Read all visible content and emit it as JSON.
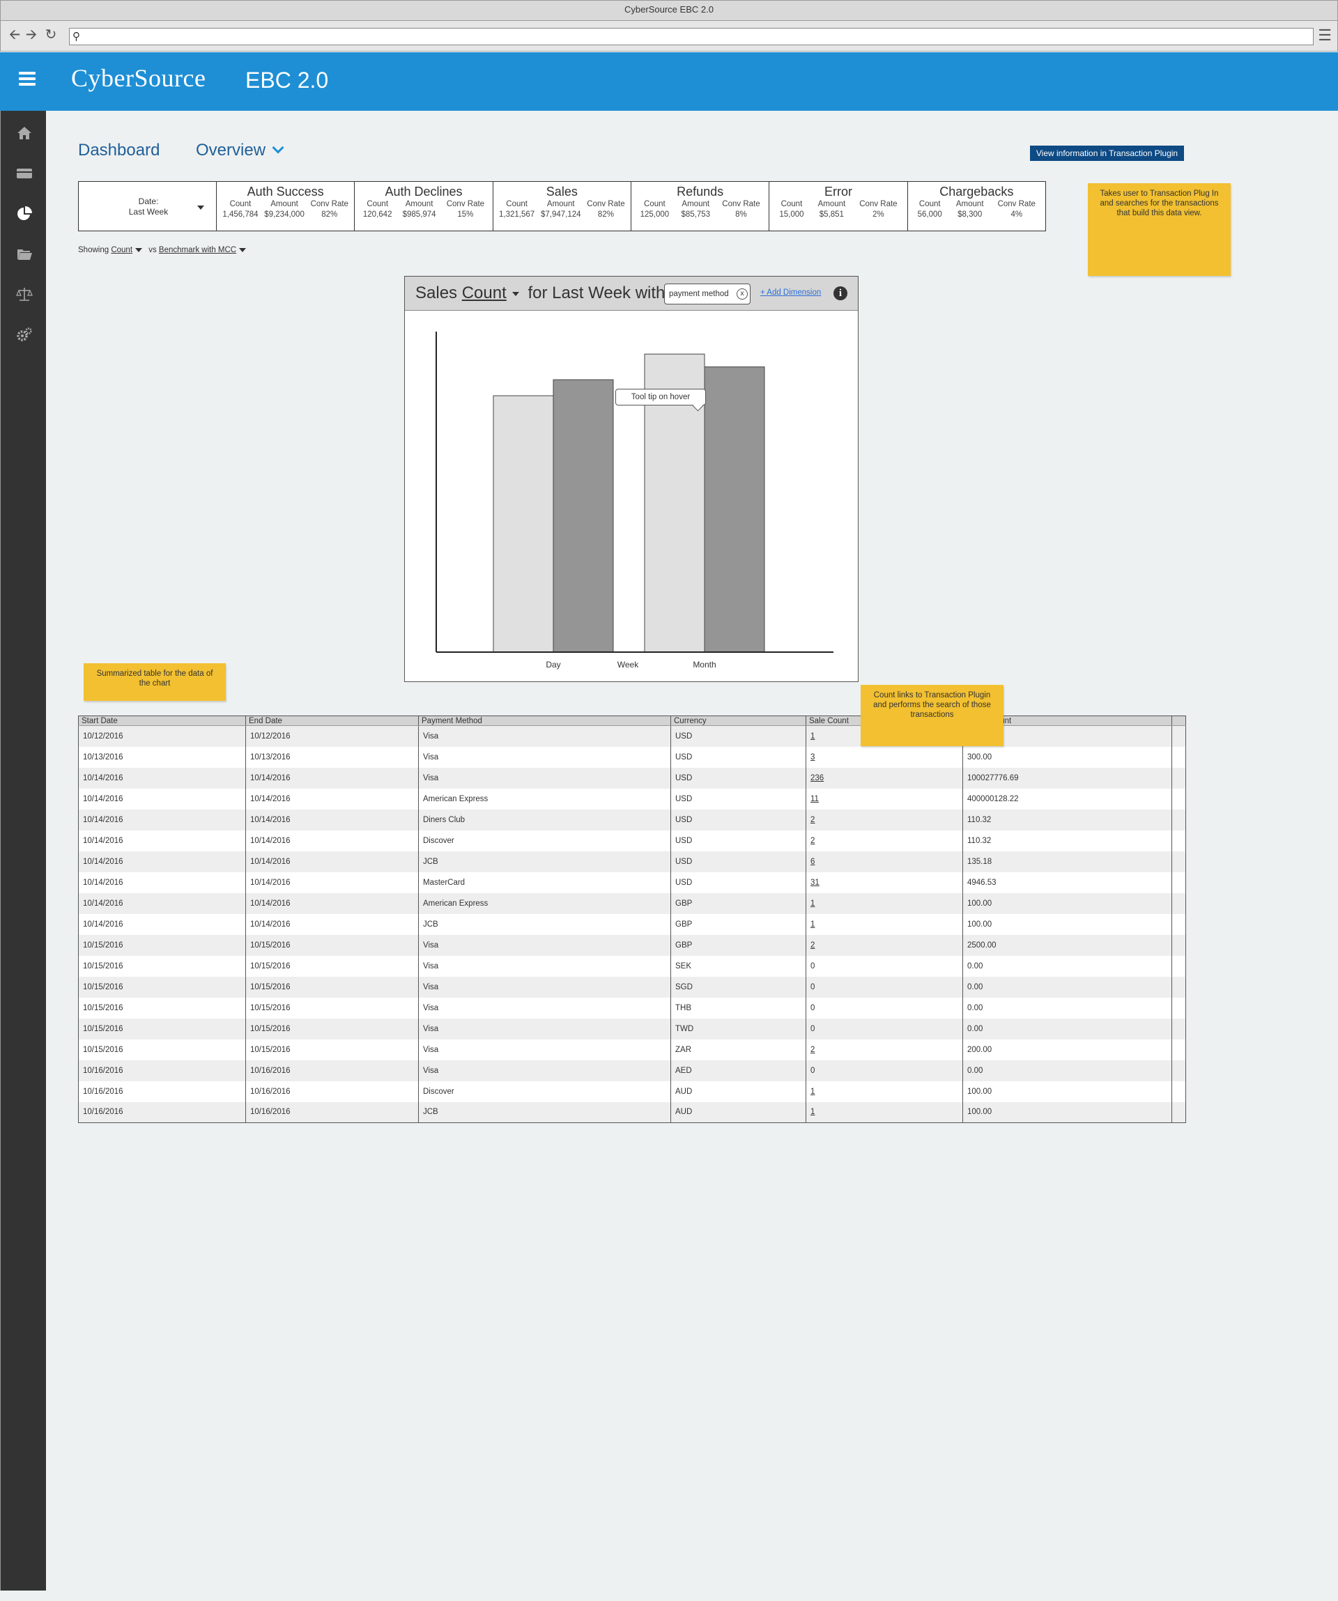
{
  "browser": {
    "title": "CyberSource EBC 2.0",
    "url": ""
  },
  "header": {
    "brand": "CyberSource",
    "product": "EBC 2.0"
  },
  "sidebar": {
    "items": [
      {
        "icon": "home-icon"
      },
      {
        "icon": "credit-card-icon"
      },
      {
        "icon": "pie-chart-icon",
        "active": true
      },
      {
        "icon": "folder-icon"
      },
      {
        "icon": "scale-icon"
      },
      {
        "icon": "gears-icon"
      }
    ]
  },
  "page": {
    "dashboard_label": "Dashboard",
    "overview_label": "Overview",
    "transaction_button": "View information in Transaction Plugin"
  },
  "metrics": {
    "date_label": "Date:",
    "date_value": "Last Week",
    "groups": [
      {
        "title": "Auth Success",
        "cols": [
          {
            "label": "Count",
            "value": "1,456,784"
          },
          {
            "label": "Amount",
            "value": "$9,234,000"
          },
          {
            "label": "Conv Rate",
            "value": "82%"
          }
        ]
      },
      {
        "title": "Auth Declines",
        "cols": [
          {
            "label": "Count",
            "value": "120,642"
          },
          {
            "label": "Amount",
            "value": "$985,974"
          },
          {
            "label": "Conv Rate",
            "value": "15%"
          }
        ]
      },
      {
        "title": "Sales",
        "cols": [
          {
            "label": "Count",
            "value": "1,321,567"
          },
          {
            "label": "Amount",
            "value": "$7,947,124"
          },
          {
            "label": "Conv Rate",
            "value": "82%"
          }
        ]
      },
      {
        "title": "Refunds",
        "cols": [
          {
            "label": "Count",
            "value": "125,000"
          },
          {
            "label": "Amount",
            "value": "$85,753"
          },
          {
            "label": "Conv Rate",
            "value": "8%"
          }
        ]
      },
      {
        "title": "Error",
        "cols": [
          {
            "label": "Count",
            "value": "15,000"
          },
          {
            "label": "Amount",
            "value": "$5,851"
          },
          {
            "label": "Conv Rate",
            "value": "2%"
          }
        ]
      },
      {
        "title": "Chargebacks",
        "cols": [
          {
            "label": "Count",
            "value": "56,000"
          },
          {
            "label": "Amount",
            "value": "$8,300"
          },
          {
            "label": "Conv Rate",
            "value": "4%"
          }
        ]
      }
    ]
  },
  "showing": {
    "prefix": "Showing",
    "metric": "Count",
    "vs": "vs",
    "benchmark": "Benchmark with MCC"
  },
  "notes": {
    "transaction_note": "Takes user to Transaction Plug In and searches for the transactions that build this data view.",
    "table_note": "Summarized table for the data of the chart",
    "count_note": "Count links to Transaction Plugin and  performs the search of those transactions"
  },
  "chart_panel": {
    "title_pre": "Sales",
    "title_metric": "Count",
    "title_mid": "for Last Week with",
    "pill_label": "payment method",
    "pill_close": "x",
    "add_dimension": "+ Add Dimension",
    "info_glyph": "i",
    "tooltip": "Tool tip on hover"
  },
  "chart_data": {
    "type": "bar",
    "categories": [
      "Day",
      "Week",
      "Month"
    ],
    "series": [
      {
        "values": [
          80,
          null,
          93
        ],
        "color": "#e0e0e0"
      },
      {
        "values": [
          85,
          null,
          89
        ],
        "color": "#959595"
      }
    ],
    "ylim": [
      0,
      100
    ],
    "title": "",
    "xlabel": "",
    "ylabel": ""
  },
  "table": {
    "columns": [
      "Start Date",
      "End Date",
      "Payment Method",
      "Currency",
      "Sale Count",
      "Sale Amount"
    ],
    "rows": [
      [
        "10/12/2016",
        "10/12/2016",
        "Visa",
        "USD",
        "1",
        ""
      ],
      [
        "10/13/2016",
        "10/13/2016",
        "Visa",
        "USD",
        "3",
        "300.00"
      ],
      [
        "10/14/2016",
        "10/14/2016",
        "Visa",
        "USD",
        "236",
        "100027776.69"
      ],
      [
        "10/14/2016",
        "10/14/2016",
        "American Express",
        "USD",
        "11",
        "400000128.22"
      ],
      [
        "10/14/2016",
        "10/14/2016",
        "Diners Club",
        "USD",
        "2",
        "110.32"
      ],
      [
        "10/14/2016",
        "10/14/2016",
        "Discover",
        "USD",
        "2",
        "110.32"
      ],
      [
        "10/14/2016",
        "10/14/2016",
        "JCB",
        "USD",
        "6",
        "135.18"
      ],
      [
        "10/14/2016",
        "10/14/2016",
        "MasterCard",
        "USD",
        "31",
        "4946.53"
      ],
      [
        "10/14/2016",
        "10/14/2016",
        "American Express",
        "GBP",
        "1",
        "100.00"
      ],
      [
        "10/14/2016",
        "10/14/2016",
        "JCB",
        "GBP",
        "1",
        "100.00"
      ],
      [
        "10/15/2016",
        "10/15/2016",
        "Visa",
        "GBP",
        "2",
        "2500.00"
      ],
      [
        "10/15/2016",
        "10/15/2016",
        "Visa",
        "SEK",
        "0",
        "0.00"
      ],
      [
        "10/15/2016",
        "10/15/2016",
        "Visa",
        "SGD",
        "0",
        "0.00"
      ],
      [
        "10/15/2016",
        "10/15/2016",
        "Visa",
        "THB",
        "0",
        "0.00"
      ],
      [
        "10/15/2016",
        "10/15/2016",
        "Visa",
        "TWD",
        "0",
        "0.00"
      ],
      [
        "10/15/2016",
        "10/15/2016",
        "Visa",
        "ZAR",
        "2",
        "200.00"
      ],
      [
        "10/16/2016",
        "10/16/2016",
        "Visa",
        "AED",
        "0",
        "0.00"
      ],
      [
        "10/16/2016",
        "10/16/2016",
        "Discover",
        "AUD",
        "1",
        "100.00"
      ],
      [
        "10/16/2016",
        "10/16/2016",
        "JCB",
        "AUD",
        "1",
        "100.00"
      ]
    ]
  }
}
